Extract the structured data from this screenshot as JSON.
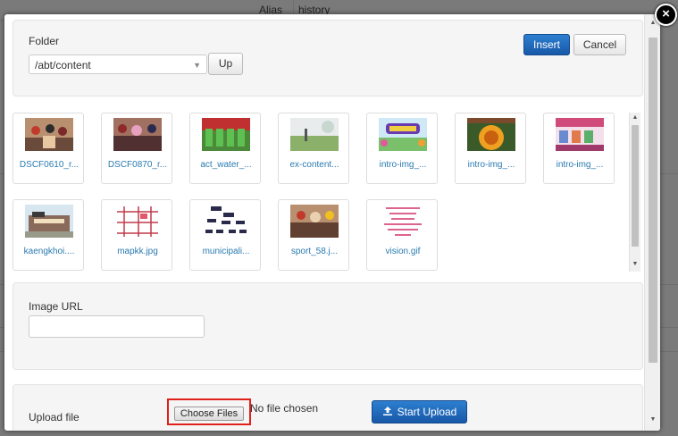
{
  "background": {
    "alias_label": "Alias",
    "alias_value": "history"
  },
  "modal": {
    "close_glyph": "×",
    "folder": {
      "label": "Folder",
      "selected": "/abt/content",
      "up_label": "Up"
    },
    "actions": {
      "insert_label": "Insert",
      "cancel_label": "Cancel"
    },
    "thumbnails": [
      {
        "name": "DSCF0610_r...",
        "icon": "photo-crowd"
      },
      {
        "name": "DSCF0870_r...",
        "icon": "photo-crowd"
      },
      {
        "name": "act_water_...",
        "icon": "photo-group-green"
      },
      {
        "name": "ex-content...",
        "icon": "photo-field"
      },
      {
        "name": "intro-img_...",
        "icon": "banner-colorful"
      },
      {
        "name": "intro-img_...",
        "icon": "banner-orange"
      },
      {
        "name": "intro-img_...",
        "icon": "banner-pink"
      },
      {
        "name": "kaengkhoi....",
        "icon": "photo-building"
      },
      {
        "name": "mapkk.jpg",
        "icon": "map-diagram"
      },
      {
        "name": "municipali...",
        "icon": "org-chart"
      },
      {
        "name": "sport_58.j...",
        "icon": "photo-crowd"
      },
      {
        "name": "vision.gif",
        "icon": "text-image-pink"
      }
    ],
    "image_url": {
      "label": "Image URL",
      "value": ""
    },
    "upload": {
      "label": "Upload file",
      "choose_label": "Choose Files",
      "no_file_text": "No file chosen",
      "start_label": "Start Upload",
      "start_icon": "upload-icon"
    },
    "colors": {
      "primary": "#1d5fae",
      "highlight": "#e0201a",
      "link": "#2a7ab0"
    }
  }
}
